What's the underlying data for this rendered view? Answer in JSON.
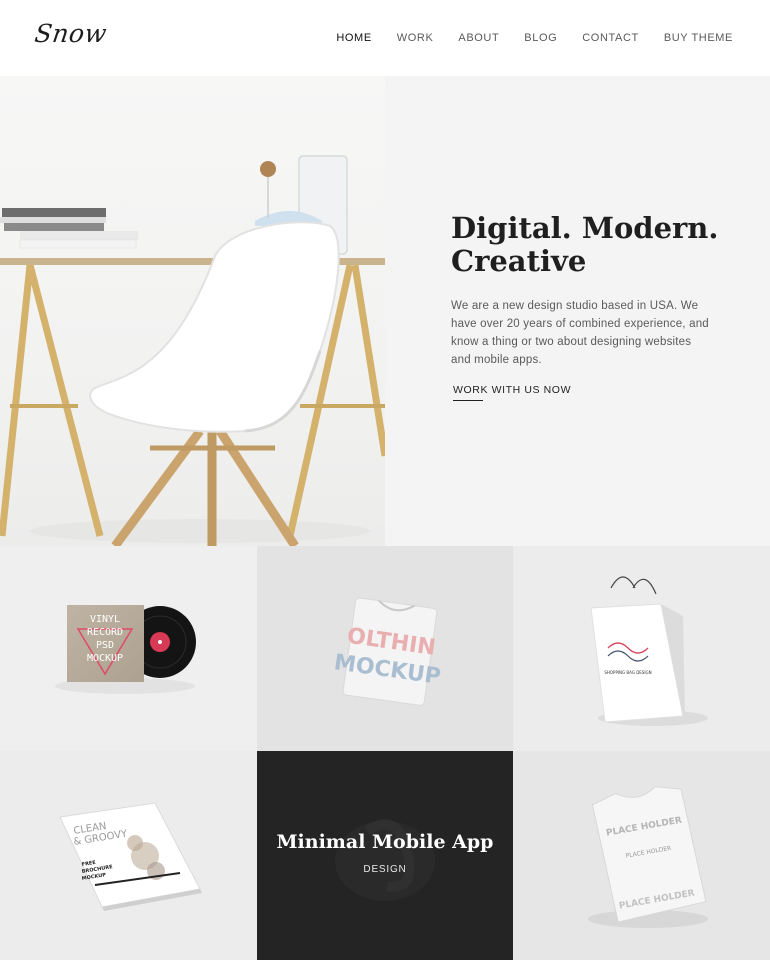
{
  "brand": {
    "logo_text": "Snow"
  },
  "nav": {
    "items": [
      "HOME",
      "WORK",
      "ABOUT",
      "BLOG",
      "CONTACT",
      "BUY THEME"
    ],
    "active": "HOME"
  },
  "hero": {
    "title_line1": "Digital. Modern.",
    "title_line2": "Creative",
    "body": "We are a new design studio based in USA. We have over 20 years of combined experience, and know a thing or two about designing websites and mobile apps.",
    "cta": "WORK WITH US NOW"
  },
  "portfolio": {
    "vinyl_cover_text": [
      "VINYL",
      "RECORD",
      "PSD",
      "MOCKUP"
    ],
    "tshirt_text": [
      "OLTHIN",
      "MOCKUP"
    ],
    "bag_text": "SHOPPING BAG DESIGN",
    "brochure_text": [
      "CLEAN",
      "& GROOVY",
      "FREE",
      "BROCHURE",
      "MOCKUP"
    ],
    "tee2_text": [
      "PLACE HOLDER",
      "PLACE HOLDER",
      "PLACE HOLDER"
    ],
    "featured": {
      "title": "Minimal Mobile App",
      "category": "DESIGN"
    }
  },
  "colors": {
    "dark_tile": "#242424",
    "text": "#1f1f1f",
    "hero_panel": "#f4f4f4"
  }
}
